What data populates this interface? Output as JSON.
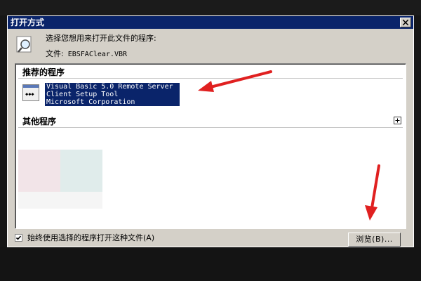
{
  "dialog": {
    "title": "打开方式",
    "prompt": "选择您想用来打开此文件的程序:",
    "file_label": "文件:",
    "file_name": "EBSFAClear.VBR"
  },
  "recommended": {
    "heading": "推荐的程序",
    "program": {
      "line1": "Visual Basic 5.0 Remote Server",
      "line2": "Client Setup Tool",
      "line3": "Microsoft Corporation"
    }
  },
  "other": {
    "heading": "其他程序"
  },
  "footer": {
    "always_use_label": "始终使用选择的程序打开这种文件(A)",
    "always_use_checked": true,
    "browse_label": "浏览(B)..."
  },
  "colors": {
    "selection": "#0a246a",
    "dialog_bg": "#d4d0c8",
    "arrow": "#e02020"
  },
  "icons": [
    "close-icon",
    "search-file-icon",
    "program-icon",
    "expand-plus-icon",
    "checkmark-icon"
  ]
}
